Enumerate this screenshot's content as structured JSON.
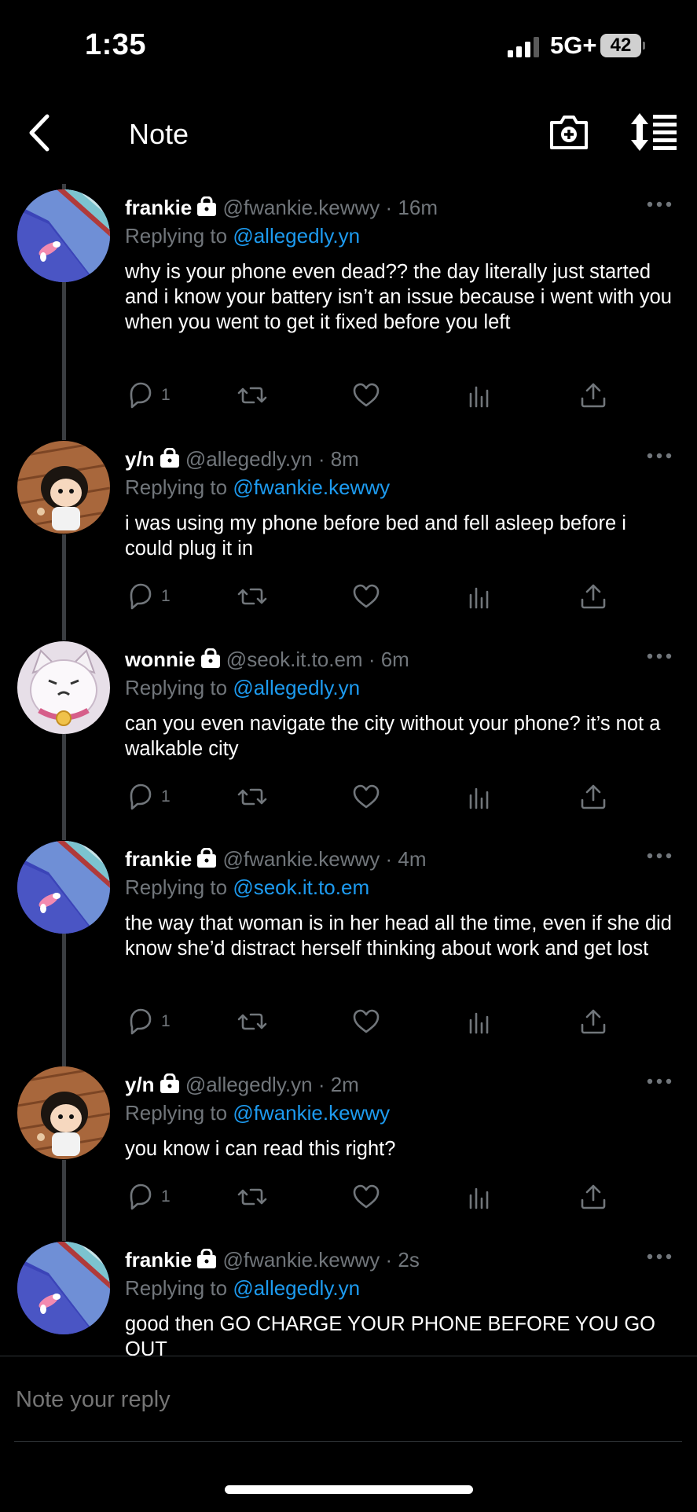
{
  "status_bar": {
    "time": "1:35",
    "network": "5G+",
    "battery": "42"
  },
  "nav": {
    "title": "Note"
  },
  "tweets": [
    {
      "name": "frankie",
      "handle": "@fwankie.kewwy",
      "time": "16m",
      "replying_label": "Replying to",
      "replying_to": "@allegedly.yn",
      "text": "why is your phone even dead?? the day literally just started and i know your battery isn’t an issue because i went with you when you went to get it fixed before you left",
      "reply_count": "1",
      "avatar": "blue-cartoon"
    },
    {
      "name": "y/n",
      "handle": "@allegedly.yn",
      "time": "8m",
      "replying_label": "Replying to",
      "replying_to": "@fwankie.kewwy",
      "text": "i was using my phone before bed and fell asleep before i could plug it in",
      "reply_count": "1",
      "avatar": "anime-boy"
    },
    {
      "name": "wonnie",
      "handle": "@seok.it.to.em",
      "time": "6m",
      "replying_label": "Replying to",
      "replying_to": "@allegedly.yn",
      "text": "can you even navigate the city without your phone? it’s not a walkable city",
      "reply_count": "1",
      "avatar": "white-cat"
    },
    {
      "name": "frankie",
      "handle": "@fwankie.kewwy",
      "time": "4m",
      "replying_label": "Replying to",
      "replying_to": "@seok.it.to.em",
      "text": "the way that woman is in her head all the time, even if she did know she’d distract herself thinking about work and get lost",
      "reply_count": "1",
      "avatar": "blue-cartoon"
    },
    {
      "name": "y/n",
      "handle": "@allegedly.yn",
      "time": "2m",
      "replying_label": "Replying to",
      "replying_to": "@fwankie.kewwy",
      "text": "you know i can read this right?",
      "reply_count": "1",
      "avatar": "anime-boy"
    },
    {
      "name": "frankie",
      "handle": "@fwankie.kewwy",
      "time": "2s",
      "replying_label": "Replying to",
      "replying_to": "@allegedly.yn",
      "text": "good then GO CHARGE YOUR PHONE BEFORE YOU GO OUT",
      "reply_count": "",
      "avatar": "blue-cartoon"
    }
  ],
  "composer": {
    "placeholder": "Note your reply"
  },
  "colors": {
    "background": "#000000",
    "link": "#1d9bf0",
    "muted": "#71767b",
    "text": "#ffffff"
  }
}
